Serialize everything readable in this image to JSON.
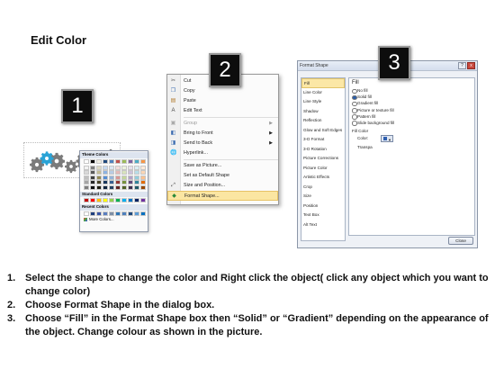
{
  "title": "Edit Color",
  "steps_badges": [
    "1",
    "2",
    "3"
  ],
  "context_menu": {
    "items": [
      {
        "label": "Cut",
        "icon": "scissors-icon",
        "disabled": false,
        "submenu": false
      },
      {
        "label": "Copy",
        "icon": "copy-icon",
        "disabled": false,
        "submenu": false
      },
      {
        "label": "Paste",
        "icon": "paste-icon",
        "disabled": false,
        "submenu": false
      },
      {
        "label": "Edit Text",
        "icon": "edit-text-icon",
        "disabled": false,
        "submenu": false
      },
      {
        "label": "Group",
        "icon": "group-icon",
        "disabled": true,
        "submenu": true
      },
      {
        "label": "Bring to Front",
        "icon": "bring-front-icon",
        "disabled": false,
        "submenu": true
      },
      {
        "label": "Send to Back",
        "icon": "send-back-icon",
        "disabled": false,
        "submenu": true
      },
      {
        "label": "Hyperlink...",
        "icon": "hyperlink-icon",
        "disabled": false,
        "submenu": false
      },
      {
        "label": "Save as Picture...",
        "icon": "",
        "disabled": false,
        "submenu": false
      },
      {
        "label": "Set as Default Shape",
        "icon": "",
        "disabled": false,
        "submenu": false
      },
      {
        "label": "Size and Position...",
        "icon": "size-icon",
        "disabled": false,
        "submenu": false
      },
      {
        "label": "Format Shape...",
        "icon": "format-shape-icon",
        "disabled": false,
        "submenu": false,
        "highlight": true
      }
    ]
  },
  "dialog": {
    "title": "Format Shape",
    "nav": [
      "Fill",
      "Line Color",
      "Line Style",
      "Shadow",
      "Reflection",
      "Glow and Soft Edges",
      "3-D Format",
      "3-D Rotation",
      "Picture Corrections",
      "Picture Color",
      "Artistic Effects",
      "Crop",
      "Size",
      "Position",
      "Text Box",
      "Alt Text"
    ],
    "section_title": "Fill",
    "fill_options": [
      "No fill",
      "Solid fill",
      "Gradient fill",
      "Picture or texture fill",
      "Pattern fill",
      "Slide background fill"
    ],
    "selected_option": 1,
    "fill_color_label": "Fill Color",
    "color_label": "Color:",
    "transparency_label": "Transpa",
    "close_label": "Close",
    "window_buttons": {
      "help": "?",
      "close": "x"
    }
  },
  "palette": {
    "theme_label": "Theme Colors",
    "standard_label": "Standard Colors",
    "recent_label": "Recent Colors",
    "more_label": "More Colors...",
    "theme_top": [
      "#ffffff",
      "#000000",
      "#eeece1",
      "#1f497d",
      "#4f81bd",
      "#c0504d",
      "#9bbb59",
      "#8064a2",
      "#4bacc6",
      "#f79646"
    ],
    "theme_shades": [
      [
        "#f2f2f2",
        "#7f7f7f",
        "#ddd9c3",
        "#c6d9f0",
        "#dbe5f1",
        "#f2dcdb",
        "#ebf1dd",
        "#e5e0ec",
        "#dbeef3",
        "#fdeada"
      ],
      [
        "#d8d8d8",
        "#595959",
        "#c4bd97",
        "#8db3e2",
        "#b8cce4",
        "#e5b9b7",
        "#d7e3bc",
        "#ccc1d9",
        "#b7dde8",
        "#fbd5b5"
      ],
      [
        "#bfbfbf",
        "#3f3f3f",
        "#938953",
        "#548dd4",
        "#95b3d7",
        "#d99694",
        "#c3d69b",
        "#b2a2c7",
        "#92cddc",
        "#fac08f"
      ],
      [
        "#a5a5a5",
        "#262626",
        "#494429",
        "#17365d",
        "#366092",
        "#953734",
        "#76923c",
        "#5f497a",
        "#31859b",
        "#e36c09"
      ],
      [
        "#7f7f7f",
        "#0c0c0c",
        "#1d1b10",
        "#0f243e",
        "#244061",
        "#632423",
        "#4f6128",
        "#3f3151",
        "#205867",
        "#974806"
      ]
    ],
    "standard": [
      "#c00000",
      "#ff0000",
      "#ffc000",
      "#ffff00",
      "#92d050",
      "#00b050",
      "#00b0f0",
      "#0070c0",
      "#002060",
      "#7030a0"
    ],
    "recent": [
      "#ffffff",
      "#1f3f7f",
      "#3a56a8",
      "#5a7fbf",
      "#7f8fa6",
      "#2e75b6",
      "#4f81bd",
      "#1f497d",
      "#5b9bd5",
      "#0070c0"
    ]
  },
  "instructions": [
    {
      "n": "1.",
      "text": "Select the shape to change the color and Right click the object( click any object which you want to change color)"
    },
    {
      "n": "2.",
      "text": "Choose Format Shape in the dialog box."
    },
    {
      "n": "3.",
      "text": "Choose “Fill” in the Format Shape box then “Solid” or “Gradient” depending on the appearance of the object. Change colour as shown in the picture."
    }
  ]
}
